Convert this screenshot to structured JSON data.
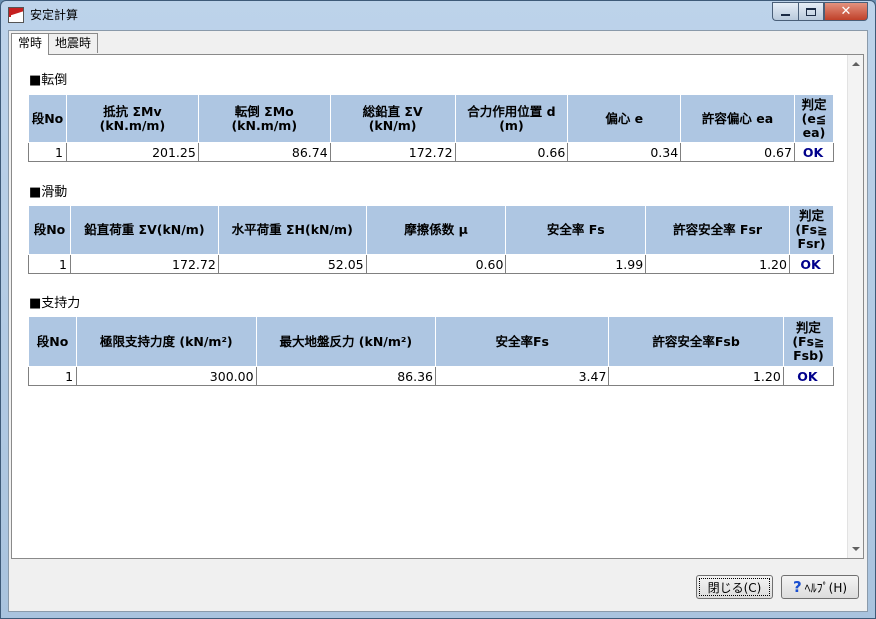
{
  "window": {
    "title": "安定計算"
  },
  "tabs": [
    {
      "label": "常時"
    },
    {
      "label": "地震時"
    }
  ],
  "overturning": {
    "title": "■転倒",
    "headers": [
      "段No",
      "抵抗 ΣMv\n(kN.m/m)",
      "転倒 ΣMo\n(kN.m/m)",
      "総鉛直 ΣV\n(kN/m)",
      "合力作用位置 d\n(m)",
      "偏心 e",
      "許容偏心 ea",
      "判定\n(e≦\nea)"
    ],
    "rows": [
      [
        "1",
        "201.25",
        "86.74",
        "172.72",
        "0.66",
        "0.34",
        "0.67",
        "OK"
      ]
    ]
  },
  "sliding": {
    "title": "■滑動",
    "headers": [
      "段No",
      "鉛直荷重 ΣV(kN/m)",
      "水平荷重 ΣH(kN/m)",
      "摩擦係数 μ",
      "安全率 Fs",
      "許容安全率 Fsr",
      "判定\n(Fs≧\nFsr)"
    ],
    "rows": [
      [
        "1",
        "172.72",
        "52.05",
        "0.60",
        "1.99",
        "1.20",
        "OK"
      ]
    ]
  },
  "bearing": {
    "title": "■支持力",
    "headers": [
      "段No",
      "極限支持力度 (kN/m²)",
      "最大地盤反力 (kN/m²)",
      "安全率Fs",
      "許容安全率Fsb",
      "判定\n(Fs≧\nFsb)"
    ],
    "rows": [
      [
        "1",
        "300.00",
        "86.36",
        "3.47",
        "1.20",
        "OK"
      ]
    ]
  },
  "buttons": {
    "close": "閉じる(C)",
    "help": "ﾍﾙﾌﾟ(H)"
  },
  "colors": {
    "header_bg": "#aec6e2",
    "ok_text": "#00008b"
  }
}
